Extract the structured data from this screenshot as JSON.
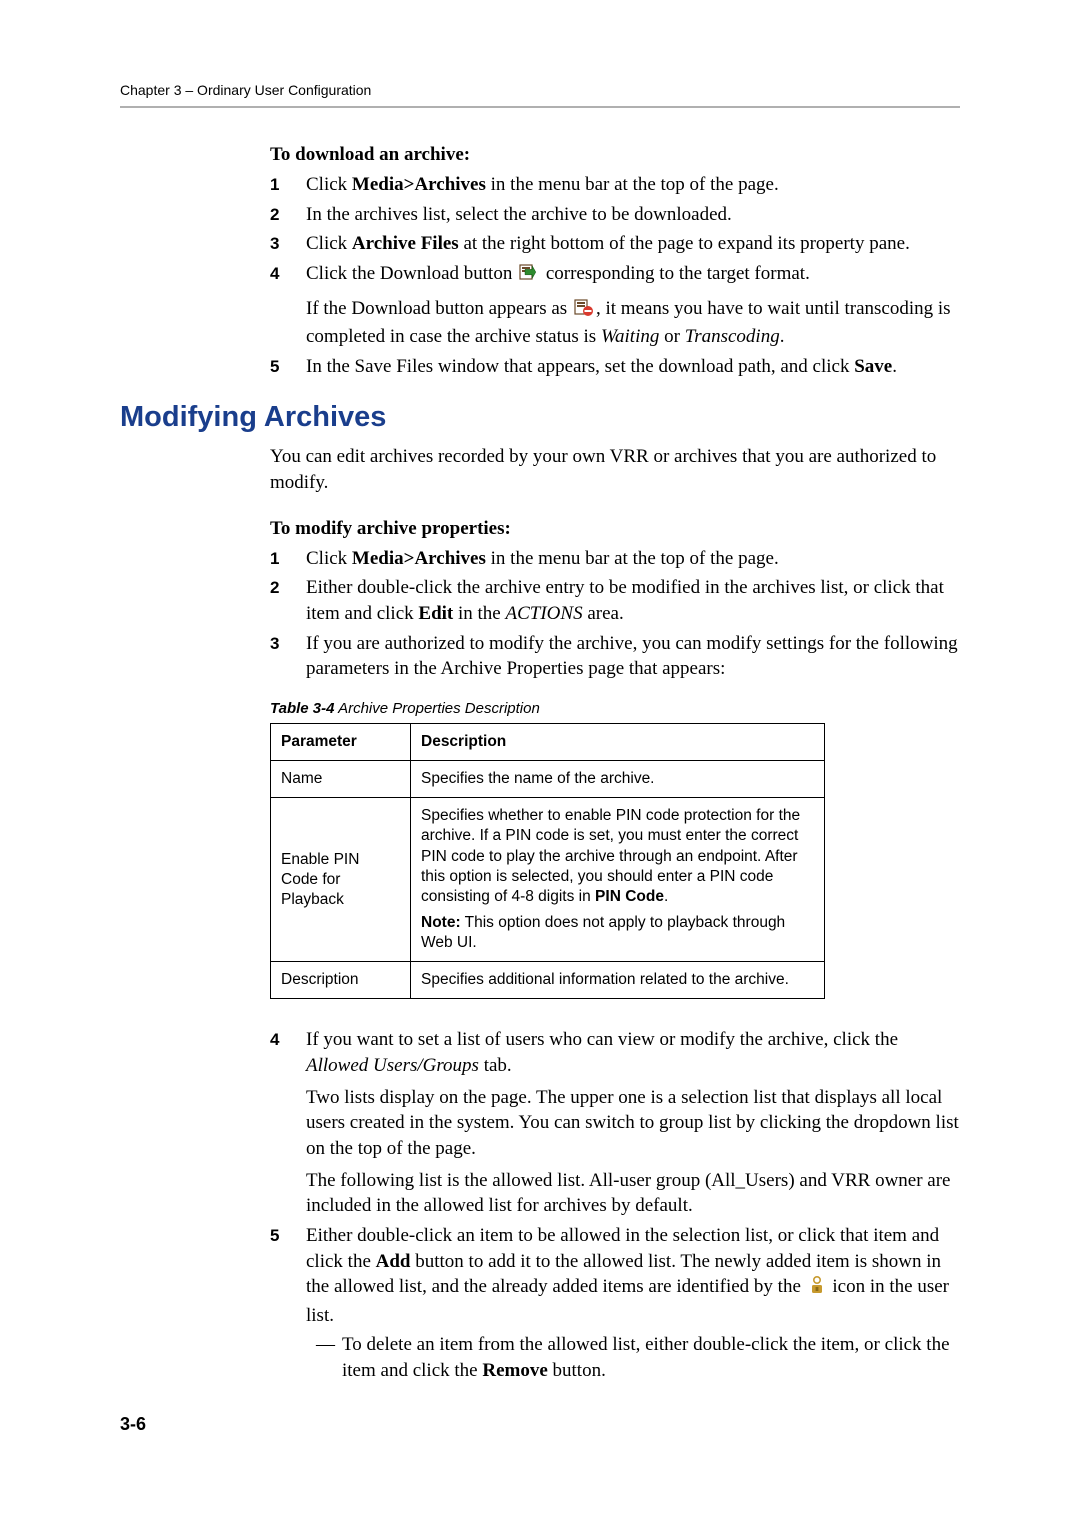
{
  "header": {
    "chapter_line": "Chapter 3 – Ordinary User Configuration"
  },
  "proc_download": {
    "title": "To download an archive:",
    "steps": {
      "s1_a": "Click ",
      "s1_b": "Media>Archives",
      "s1_c": " in the menu bar at the top of the page.",
      "s2": "In the archives list, select the archive to be downloaded.",
      "s3_a": "Click ",
      "s3_b": "Archive Files",
      "s3_c": " at the right bottom of the page to expand its property pane.",
      "s4_a": "Click the Download button ",
      "s4_b": " corresponding to the target format.",
      "s4_sub_a": "If the Download button appears as ",
      "s4_sub_b": ", it means you have to wait until transcoding is completed in case the archive status is ",
      "s4_sub_c": "Waiting",
      "s4_sub_d": " or ",
      "s4_sub_e": "Transcoding",
      "s4_sub_f": ".",
      "s5_a": "In the Save Files window that appears, set the download path, and click ",
      "s5_b": "Save",
      "s5_c": "."
    }
  },
  "section_title": "Modifying Archives",
  "intro_para": "You can edit archives recorded by your own VRR or archives that you are authorized to modify.",
  "proc_modify": {
    "title": "To modify archive properties:",
    "steps": {
      "s1_a": "Click ",
      "s1_b": "Media>Archives",
      "s1_c": " in the menu bar at the top of the page.",
      "s2_a": "Either double-click the archive entry to be modified in the archives list, or click that item and click ",
      "s2_b": "Edit",
      "s2_c": " in the ",
      "s2_d": "ACTIONS",
      "s2_e": " area.",
      "s3": "If you are authorized to modify the archive, you can modify settings for the following parameters in the Archive Properties page that appears:"
    }
  },
  "table": {
    "label": "Table 3-4",
    "caption": " Archive Properties Description",
    "head_param": "Parameter",
    "head_desc": "Description",
    "rows": {
      "r1_param": "Name",
      "r1_desc": "Specifies the name of the archive.",
      "r2_param": "Enable PIN Code for Playback",
      "r2_desc_a": "Specifies whether to enable PIN code protection for the archive. If a PIN code is set, you must enter the correct PIN code to play the archive through an endpoint.   After this option is selected, you should enter a PIN code consisting of 4-8 digits in ",
      "r2_desc_b": "PIN Code",
      "r2_desc_c": ".",
      "r2_note_lead": "Note:",
      "r2_note_body": " This option does not apply to playback through Web UI.",
      "r3_param": "Description",
      "r3_desc": "Specifies additional information related to the archive."
    }
  },
  "post_steps": {
    "s4_a": "If you want to set a list of users who can view or modify the archive, click the ",
    "s4_b": "Allowed Users/Groups",
    "s4_c": " tab.",
    "s4_sub1": "Two lists display on the page. The upper one is a selection list that displays all local users created in the system. You can switch to group list by clicking the dropdown list on the top of the page.",
    "s4_sub2": "The following list is the allowed list. All-user group (All_Users) and VRR owner are included in the allowed list for archives by default.",
    "s5_a": "Either double-click an item to be allowed in the selection list, or click that item and click the ",
    "s5_b": "Add",
    "s5_c": " button to add it to the allowed list. The newly added item is shown in the allowed list, and the already added items are identified by the ",
    "s5_d": " icon in the user list.",
    "s5_dash_a": "To delete an item from the allowed list, either double-click the item, or click the item and click the ",
    "s5_dash_b": "Remove",
    "s5_dash_c": " button."
  },
  "page_number": "3-6"
}
